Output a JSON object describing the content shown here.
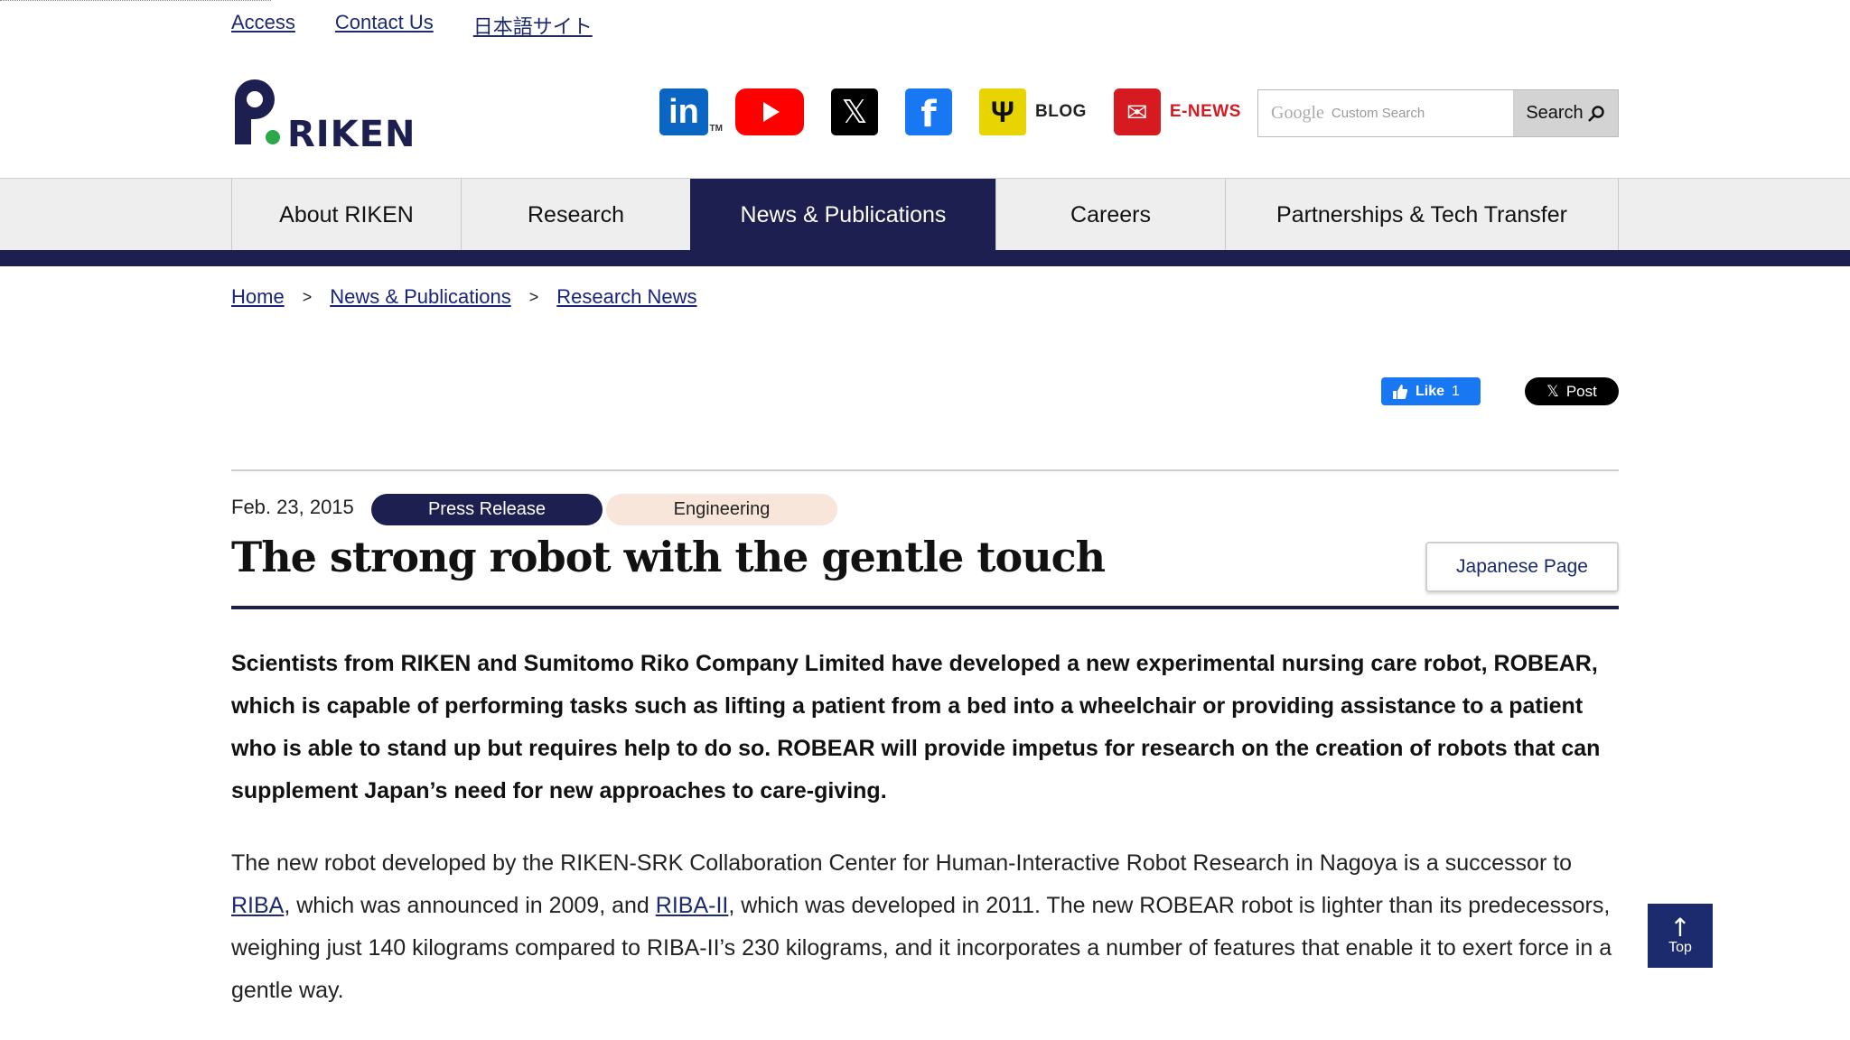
{
  "util_links": [
    "Access",
    "Contact Us",
    "日本語サイト"
  ],
  "logo": {
    "text": "RIKEN"
  },
  "social": {
    "linkedin": "in",
    "linkedin_tm": "TM",
    "x": "𝕏",
    "facebook": "f",
    "blog_label": "BLOG",
    "enews_label": "E-NEWS"
  },
  "search": {
    "placeholder_brand": "Google",
    "placeholder": "Custom Search",
    "button_label": "Search"
  },
  "nav": {
    "items": [
      "About RIKEN",
      "Research",
      "News & Publications",
      "Careers",
      "Partnerships & Tech Transfer"
    ],
    "active_index": 2
  },
  "breadcrumb": {
    "items": [
      "Home",
      "News & Publications",
      "Research News"
    ],
    "separator": ">"
  },
  "share": {
    "like_label": "Like",
    "like_count": "1",
    "post_label": "Post"
  },
  "article": {
    "date": "Feb. 23, 2015",
    "tags": [
      "Press Release",
      "Engineering"
    ],
    "title": "The strong robot with the gentle touch",
    "japanese_page_label": "Japanese Page",
    "lead": "Scientists from RIKEN and Sumitomo Riko Company Limited have developed a new experimental nursing care robot, ROBEAR, which is capable of performing tasks such as lifting a patient from a bed into a wheelchair or providing assistance to a patient who is able to stand up but requires help to do so. ROBEAR will provide impetus for research on the creation of robots that can supplement Japan’s need for new approaches to care-giving.",
    "body_part1": "The new robot developed by the RIKEN-SRK Collaboration Center for Human-Interactive Robot Research in Nagoya is a successor to ",
    "body_link1": "RIBA",
    "body_part2": ", which was announced in 2009, and ",
    "body_link2": "RIBA-II",
    "body_part3": ", which was developed in 2011. The new ROBEAR robot is lighter than its predecessors, weighing just 140 kilograms compared to RIBA-II’s 230 kilograms, and it incorporates a number of features that enable it to exert force in a gentle way."
  },
  "top_button": {
    "arrow": "↑",
    "label": "Top"
  },
  "colors": {
    "navy": "#1c1f4f",
    "link": "#1c2a6e",
    "engineering_tag": "#f7e6d9"
  }
}
